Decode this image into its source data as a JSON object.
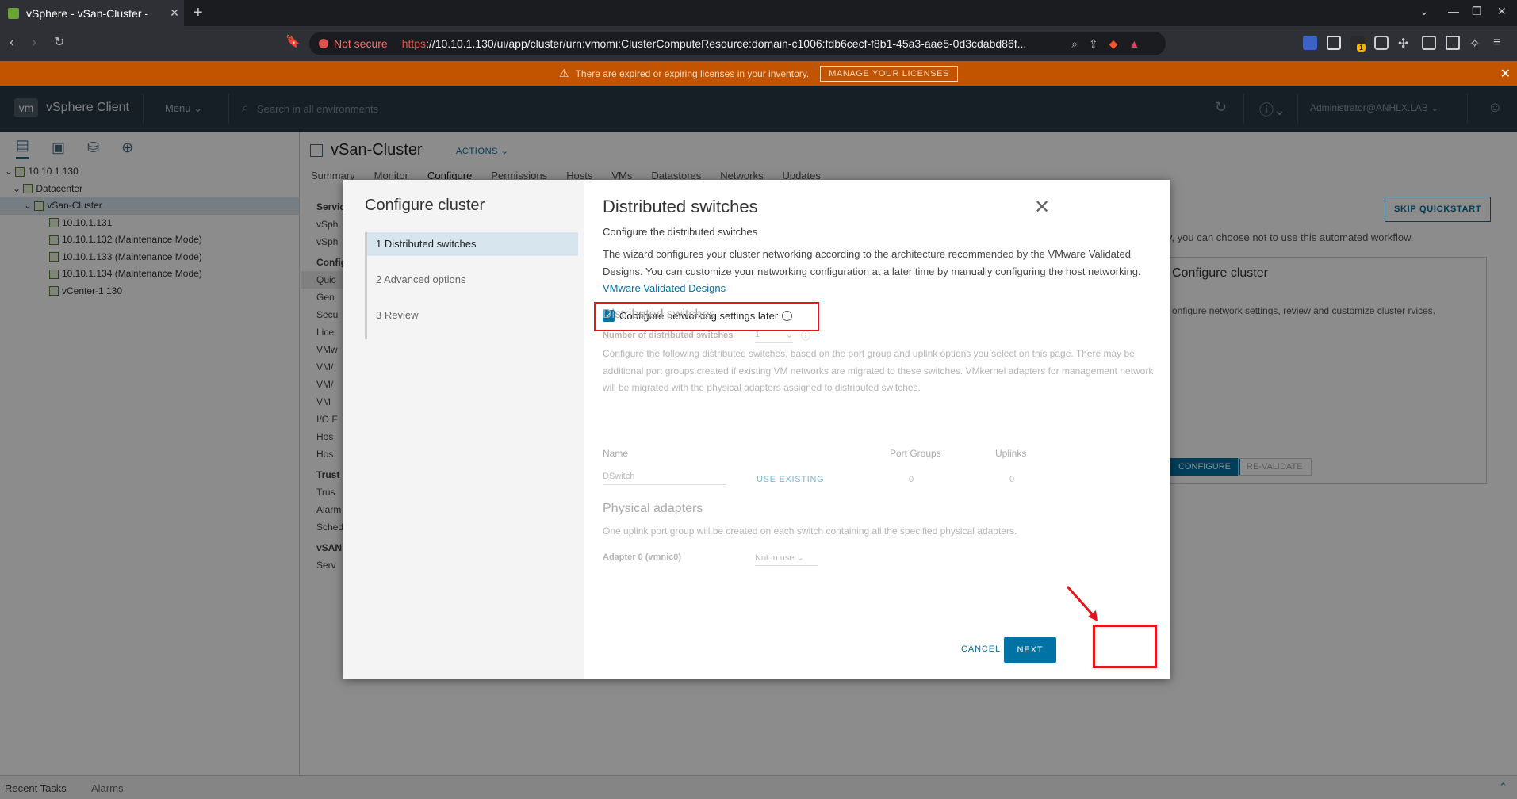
{
  "browser": {
    "tab_title": "vSphere - vSan-Cluster - ",
    "not_secure": "Not secure",
    "url_scheme": "https",
    "url_rest": "://10.10.1.130/ui/app/cluster/urn:vmomi:ClusterComputeResource:domain-c1006:fdb6cecf-f8b1-45a3-aae5-0d3cdabd86f...",
    "badge_count": "1"
  },
  "banner": {
    "text": "There are expired or expiring licenses in your inventory.",
    "button": "MANAGE YOUR LICENSES"
  },
  "header": {
    "logo": "vm",
    "app_name": "vSphere Client",
    "menu": "Menu",
    "search_placeholder": "Search in all environments",
    "user": "Administrator@ANHLX.LAB"
  },
  "tree": [
    {
      "label": "10.10.1.130",
      "level": 0
    },
    {
      "label": "Datacenter",
      "level": 1
    },
    {
      "label": "vSan-Cluster",
      "level": 2,
      "selected": true
    },
    {
      "label": "10.10.1.131",
      "level": 3
    },
    {
      "label": "10.10.1.132 (Maintenance Mode)",
      "level": 3
    },
    {
      "label": "10.10.1.133 (Maintenance Mode)",
      "level": 3
    },
    {
      "label": "10.10.1.134 (Maintenance Mode)",
      "level": 3
    },
    {
      "label": "vCenter-1.130",
      "level": 3
    }
  ],
  "content": {
    "title": "vSan-Cluster",
    "actions": "ACTIONS",
    "tabs": [
      "Summary",
      "Monitor",
      "Configure",
      "Permissions",
      "Hosts",
      "VMs",
      "Datastores",
      "Networks",
      "Updates"
    ],
    "subnav": [
      "Servic",
      "vSph",
      "vSph",
      "Config",
      "Quic",
      "Gen",
      "Secu",
      "Lice",
      "VMw",
      "VM/",
      "VM/",
      "VM",
      "I/O F",
      "Hos",
      "Hos",
      "Trust",
      "Trus",
      "Alarm",
      "Sched",
      "vSAN",
      "Serv"
    ],
    "skip_quickstart": "SKIP QUICKSTART",
    "bg_text": "ly, you can choose not to use this automated workflow.",
    "bg_card_title": "Configure cluster",
    "bg_card_text": "onfigure network settings, review and customize cluster rvices.",
    "bg_btn_configure": "CONFIGURE",
    "bg_btn_revalidate": "RE-VALIDATE"
  },
  "bottom": {
    "recent_tasks": "Recent Tasks",
    "alarms": "Alarms"
  },
  "modal": {
    "wizard_title": "Configure cluster",
    "steps": [
      "1  Distributed switches",
      "2  Advanced options",
      "3  Review"
    ],
    "title": "Distributed switches",
    "subtitle": "Configure the distributed switches",
    "description": "The wizard configures your cluster networking according to the architecture recommended by the VMware Validated Designs. You can customize your networking configuration at a later time by manually configuring the host networking. ",
    "link": "VMware Validated Designs",
    "checkbox_label": "Configure networking settings later",
    "section_ds": "Distributed switches",
    "num_ds_label": "Number of distributed switches",
    "num_ds_value": "1",
    "ds_desc": "Configure the following distributed switches, based on the port group and uplink options you select on this page. There may be additional port groups created if existing VM networks are migrated to these switches. VMkernel adapters for management network will be migrated with the physical adapters assigned to distributed switches.",
    "col_name": "Name",
    "col_portgroups": "Port Groups",
    "col_uplinks": "Uplinks",
    "ds_name": "DSwitch",
    "use_existing": "USE EXISTING",
    "portgroups_val": "0",
    "uplinks_val": "0",
    "section_pa": "Physical adapters",
    "pa_desc": "One uplink port group will be created on each switch containing all the specified physical adapters.",
    "adapter_label": "Adapter 0 (vmnic0)",
    "adapter_value": "Not in use",
    "cancel": "CANCEL",
    "next": "NEXT"
  },
  "colors": {
    "accent": "#0072a3",
    "highlight": "#e5151c",
    "banner": "#c25400",
    "header": "#2b3a46"
  }
}
